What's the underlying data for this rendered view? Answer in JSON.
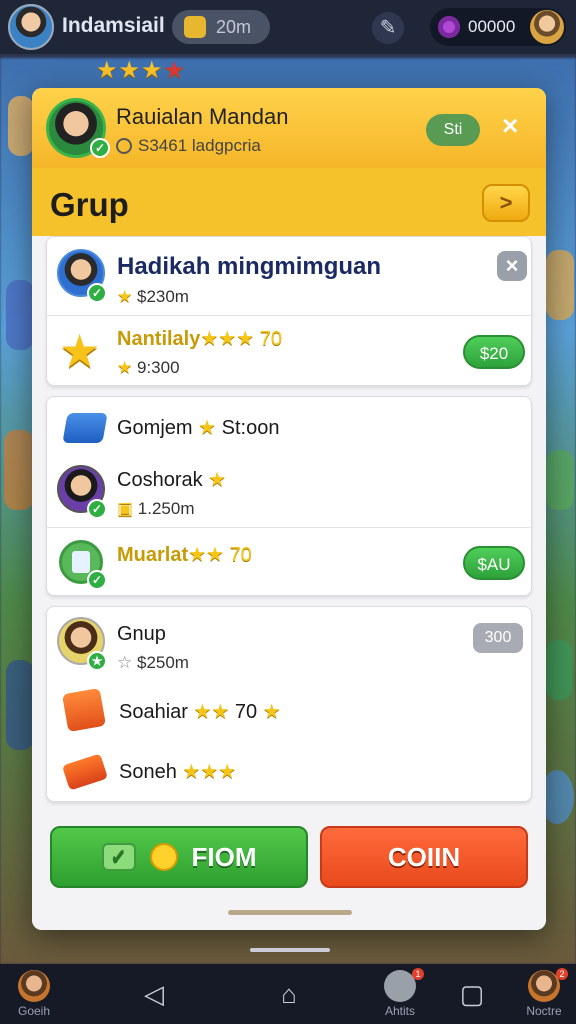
{
  "topbar": {
    "player_name": "Indamsiail",
    "pill_value": "20m",
    "coin_value": "00000"
  },
  "profile": {
    "name": "Rauialan Mandan",
    "subtitle": "S3461 ladgpcria",
    "status_label": "Sti",
    "close_label": "×"
  },
  "group": {
    "title": "Grup",
    "arrow_label": ">"
  },
  "card1": {
    "header_title": "Hadikah mingmimguan",
    "header_sub": "$230m",
    "close_label": "×",
    "reward_title": "Nantilaly",
    "reward_extra": "★★★ 70",
    "reward_sub": "9:300",
    "reward_button": "$20"
  },
  "card2": {
    "row1_title": "Gomjem",
    "row1_extra": "St:oon",
    "row2_title": "Coshorak",
    "row2_sub": "1.250m",
    "row3_title": "Muarlat",
    "row3_extra": "★★ 70",
    "row3_button": "$AU"
  },
  "card3": {
    "row1_title": "Gnup",
    "row1_sub": "$250m",
    "row1_badge": "300",
    "row2_title": "Soahiar",
    "row2_extra": "70",
    "row3_title": "Soneh"
  },
  "actions": {
    "primary_label": "FIOM",
    "secondary_label": "COIIN"
  },
  "navbar": {
    "item1_label": "Goeih",
    "item4_label": "Ahtits",
    "item6_label": "Noctre",
    "item4_badge": "1",
    "item6_badge": "2"
  },
  "colors": {
    "accent_yellow": "#f6c22c",
    "primary_green": "#3fb63f",
    "secondary_orange": "#ef5a26",
    "title_blue": "#1b2a62"
  }
}
